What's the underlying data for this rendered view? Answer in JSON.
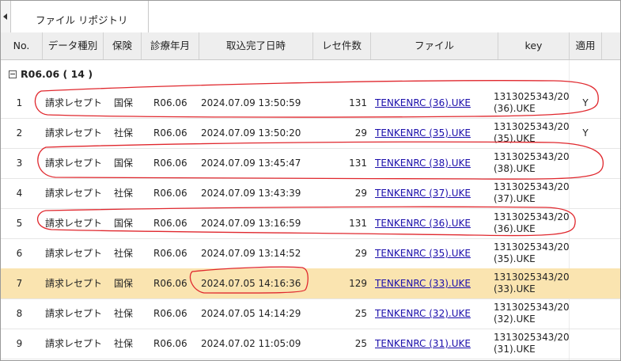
{
  "tab": {
    "label": "ファイル リポジトリ"
  },
  "columns": [
    "No.",
    "データ種別",
    "保険",
    "診療年月",
    "取込完了日時",
    "レセ件数",
    "ファイル",
    "key",
    "適用"
  ],
  "group": {
    "label": "R06.06 ( 14 )"
  },
  "rows": [
    {
      "no": "1",
      "type": "請求レセプト",
      "ins": "国保",
      "month": "R06.06",
      "datetime": "2024.07.09 13:50:59",
      "count": "131",
      "file": "TENKENRC (36).UKE",
      "key1": "1313025343/202…",
      "key2": "(36).UKE",
      "apply": "Y"
    },
    {
      "no": "2",
      "type": "請求レセプト",
      "ins": "社保",
      "month": "R06.06",
      "datetime": "2024.07.09 13:50:20",
      "count": "29",
      "file": "TENKENRC (35).UKE",
      "key1": "1313025343/202…",
      "key2": "(35).UKE",
      "apply": "Y"
    },
    {
      "no": "3",
      "type": "請求レセプト",
      "ins": "国保",
      "month": "R06.06",
      "datetime": "2024.07.09 13:45:47",
      "count": "131",
      "file": "TENKENRC (38).UKE",
      "key1": "1313025343/202…",
      "key2": "(38).UKE",
      "apply": ""
    },
    {
      "no": "4",
      "type": "請求レセプト",
      "ins": "社保",
      "month": "R06.06",
      "datetime": "2024.07.09 13:43:39",
      "count": "29",
      "file": "TENKENRC (37).UKE",
      "key1": "1313025343/202…",
      "key2": "(37).UKE",
      "apply": ""
    },
    {
      "no": "5",
      "type": "請求レセプト",
      "ins": "国保",
      "month": "R06.06",
      "datetime": "2024.07.09 13:16:59",
      "count": "131",
      "file": "TENKENRC (36).UKE",
      "key1": "1313025343/202…",
      "key2": "(36).UKE",
      "apply": ""
    },
    {
      "no": "6",
      "type": "請求レセプト",
      "ins": "社保",
      "month": "R06.06",
      "datetime": "2024.07.09 13:14:52",
      "count": "29",
      "file": "TENKENRC (35).UKE",
      "key1": "1313025343/202…",
      "key2": "(35).UKE",
      "apply": ""
    },
    {
      "no": "7",
      "type": "請求レセプト",
      "ins": "国保",
      "month": "R06.06",
      "datetime": "2024.07.05 14:16:36",
      "count": "129",
      "file": "TENKENRC (33).UKE",
      "key1": "1313025343/202…",
      "key2": "(33).UKE",
      "apply": ""
    },
    {
      "no": "8",
      "type": "請求レセプト",
      "ins": "社保",
      "month": "R06.06",
      "datetime": "2024.07.05 14:14:29",
      "count": "25",
      "file": "TENKENRC (32).UKE",
      "key1": "1313025343/202…",
      "key2": "(32).UKE",
      "apply": ""
    },
    {
      "no": "9",
      "type": "請求レセプト",
      "ins": "社保",
      "month": "R06.06",
      "datetime": "2024.07.02 11:05:09",
      "count": "25",
      "file": "TENKENRC (31).UKE",
      "key1": "1313025343/202…",
      "key2": "(31).UKE",
      "apply": ""
    }
  ],
  "colors": {
    "selected_row": "#fae4b0",
    "annotation": "#e0282e",
    "link": "#1a0dab"
  }
}
